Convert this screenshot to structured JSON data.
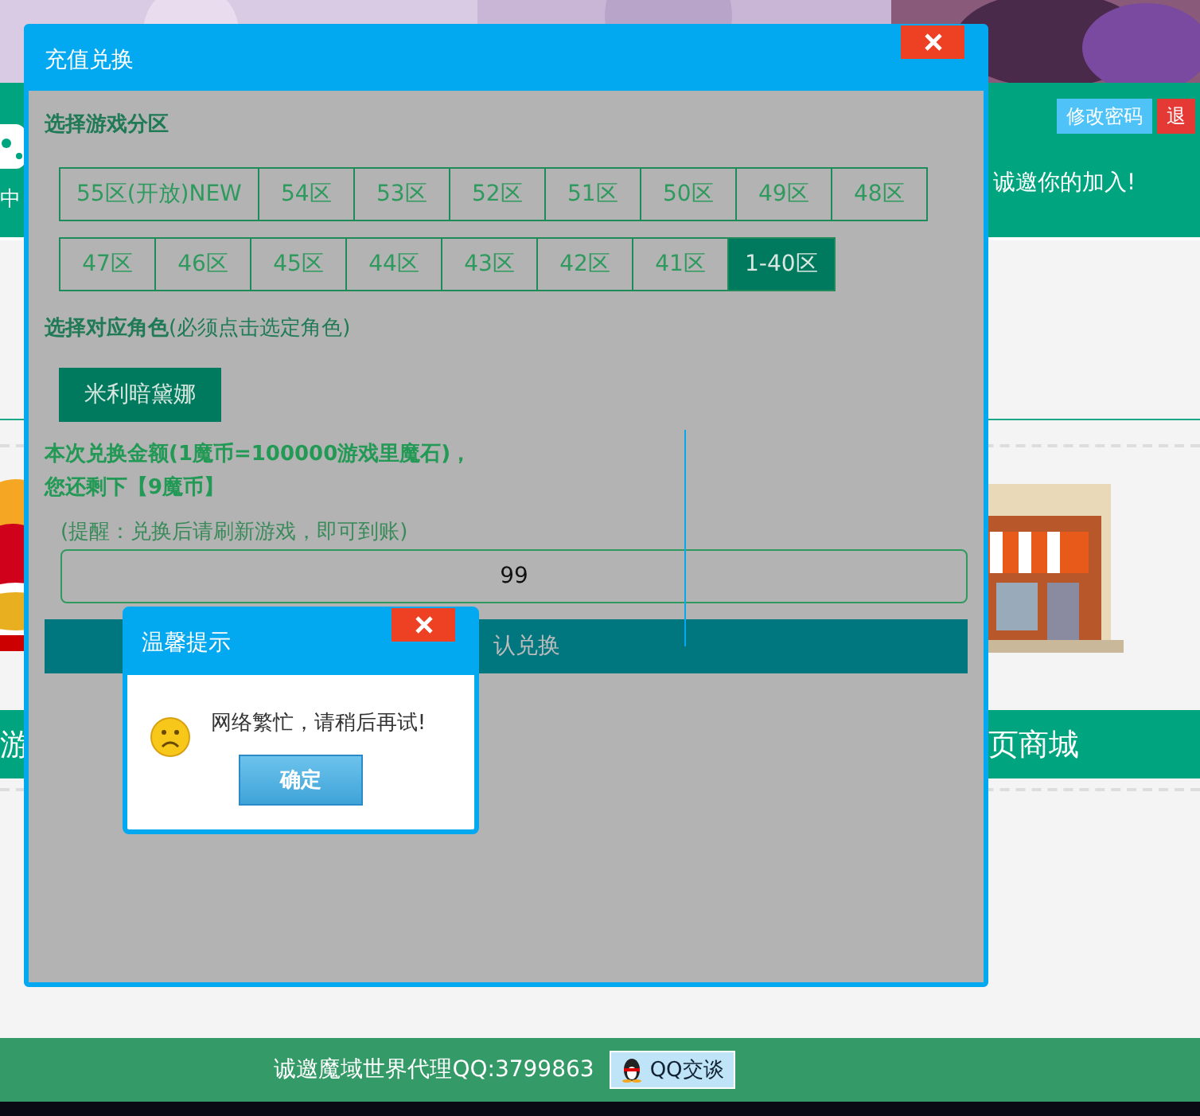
{
  "page": {
    "header": {
      "side_text": "中",
      "slogan": "诚邀你的加入!",
      "buttons": [
        {
          "label": "修改密码",
          "kind": "info"
        },
        {
          "label": "退",
          "kind": "danger"
        }
      ]
    },
    "band": {
      "left_text": "游",
      "right_text": "页商城"
    },
    "footer": {
      "text": "诚邀魔域世界代理QQ:3799863",
      "chat_button": "QQ交谈"
    }
  },
  "modal": {
    "title": "充值兑换",
    "zone_label": "选择游戏分区",
    "zone_rows": [
      [
        {
          "label": "55区(开放)NEW",
          "selected": false
        },
        {
          "label": "54区",
          "selected": false
        },
        {
          "label": "53区",
          "selected": false
        },
        {
          "label": "52区",
          "selected": false
        },
        {
          "label": "51区",
          "selected": false
        },
        {
          "label": "50区",
          "selected": false
        },
        {
          "label": "49区",
          "selected": false
        },
        {
          "label": "48区",
          "selected": false
        }
      ],
      [
        {
          "label": "47区",
          "selected": false
        },
        {
          "label": "46区",
          "selected": false
        },
        {
          "label": "45区",
          "selected": false
        },
        {
          "label": "44区",
          "selected": false
        },
        {
          "label": "43区",
          "selected": false
        },
        {
          "label": "42区",
          "selected": false
        },
        {
          "label": "41区",
          "selected": false
        },
        {
          "label": "1-40区",
          "selected": true
        }
      ]
    ],
    "role_label": "**选择对应角色**(必须点击选定角色)",
    "roles": [
      {
        "label": "米利暗黛娜",
        "selected": true
      }
    ],
    "amount_lines": [
      "本次兑换金额(1魔币=100000游戏里魔石)，",
      "您还剩下【9魔币】"
    ],
    "hint": "(提醒：兑换后请刷新游戏，即可到账)",
    "amount_value": "99",
    "confirm_label": "认兑换"
  },
  "alert": {
    "title": "温馨提示",
    "message": "网络繁忙，请稍后再试!",
    "ok_label": "确定"
  }
}
